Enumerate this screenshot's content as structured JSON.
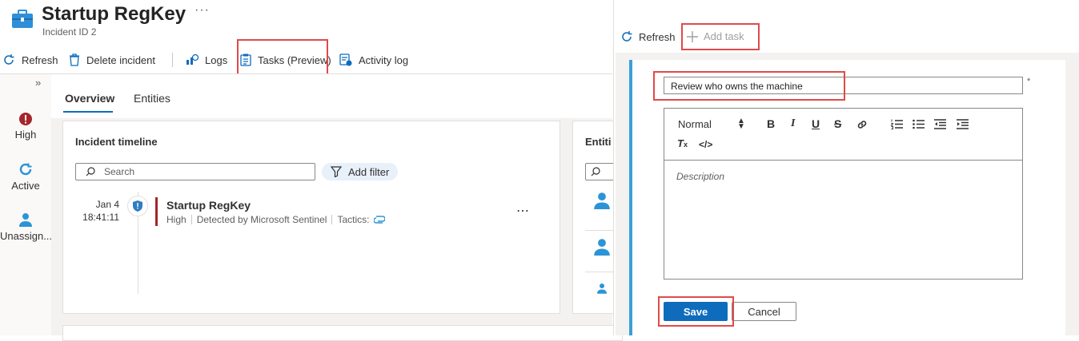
{
  "header": {
    "title": "Startup RegKey",
    "subtitle": "Incident ID 2",
    "more": "···"
  },
  "toolbar": {
    "refresh": "Refresh",
    "delete": "Delete incident",
    "logs": "Logs",
    "tasks": "Tasks (Preview)",
    "activity": "Activity log"
  },
  "status": {
    "severity": "High",
    "state": "Active",
    "owner": "Unassign..."
  },
  "tabs": [
    "Overview",
    "Entities"
  ],
  "timeline": {
    "title": "Incident timeline",
    "search_placeholder": "Search",
    "add_filter": "Add filter",
    "item": {
      "date": "Jan 4",
      "time": "18:41:11",
      "name": "Startup RegKey",
      "severity": "High",
      "detected_by": "Detected by Microsoft Sentinel",
      "tactics_label": "Tactics:"
    },
    "more": "⋯"
  },
  "entities": {
    "title": "Entiti"
  },
  "task_panel": {
    "refresh": "Refresh",
    "add_task": "Add task",
    "title_value": "Review who owns the machine",
    "required_mark": "*",
    "format": "Normal",
    "description_placeholder": "Description",
    "save": "Save",
    "cancel": "Cancel"
  },
  "colors": {
    "accent": "#0f6cbd",
    "severity_high": "#a4262c",
    "highlight": "#e04a4a",
    "form_rule": "#3aa0d8"
  }
}
